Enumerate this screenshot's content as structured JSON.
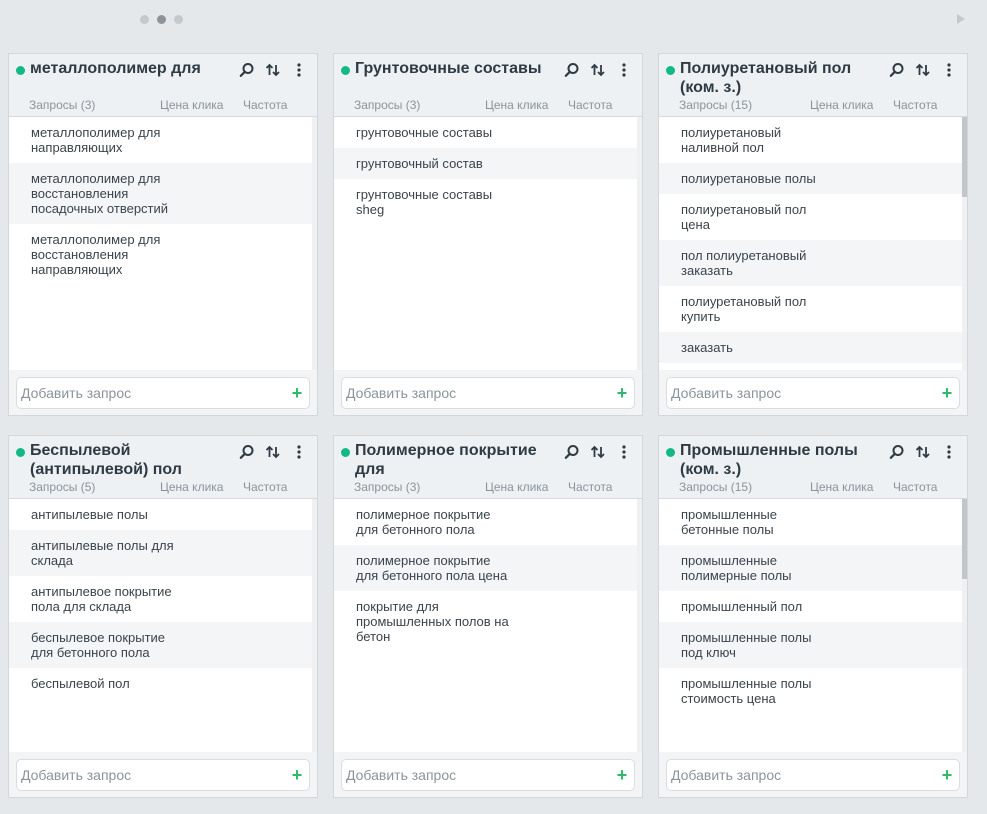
{
  "add_placeholder": "Добавить запрос",
  "add_plus": "+",
  "columns": {
    "price": "Цена клика",
    "freq": "Частота"
  },
  "cards": [
    {
      "title": "металлополимер для",
      "count": "Запросы (3)",
      "items": [
        "металлополимер для направляющих",
        "металлополимер для восстановления посадочных отверстий",
        "металлополимер для восстановления направляющих"
      ],
      "scroll": false
    },
    {
      "title": "Грунтовочные составы",
      "count": "Запросы (3)",
      "items": [
        "грунтовочные составы",
        "грунтовочный состав",
        "грунтовочные составы sheg"
      ],
      "scroll": false
    },
    {
      "title": "Полиуретановый пол (ком. з.)",
      "count": "Запросы (15)",
      "items": [
        "полиуретановый наливной пол",
        "полиуретановые полы",
        "полиуретановый пол цена",
        "пол полиуретановый заказать",
        "полиуретановый пол купить",
        "заказать"
      ],
      "scroll": true
    },
    {
      "title": "Беспылевой (антипылевой) пол",
      "count": "Запросы (5)",
      "items": [
        "антипылевые полы",
        "антипылевые полы для склада",
        "антипылевое покрытие пола для склада",
        "беспылевое покрытие для бетонного пола",
        "беспылевой пол"
      ],
      "scroll": false
    },
    {
      "title": "Полимерное покрытие для",
      "count": "Запросы (3)",
      "items": [
        "полимерное покрытие для бетонного пола",
        "полимерное покрытие для бетонного пола цена",
        "покрытие для промышленных полов на бетон"
      ],
      "scroll": false
    },
    {
      "title": "Промышленные полы (ком. з.)",
      "count": "Запросы (15)",
      "items": [
        "промышленные бетонные полы",
        "промышленные полимерные полы",
        "промышленный пол",
        "промышленные полы под ключ",
        "промышленные полы стоимость цена"
      ],
      "scroll": true
    }
  ]
}
